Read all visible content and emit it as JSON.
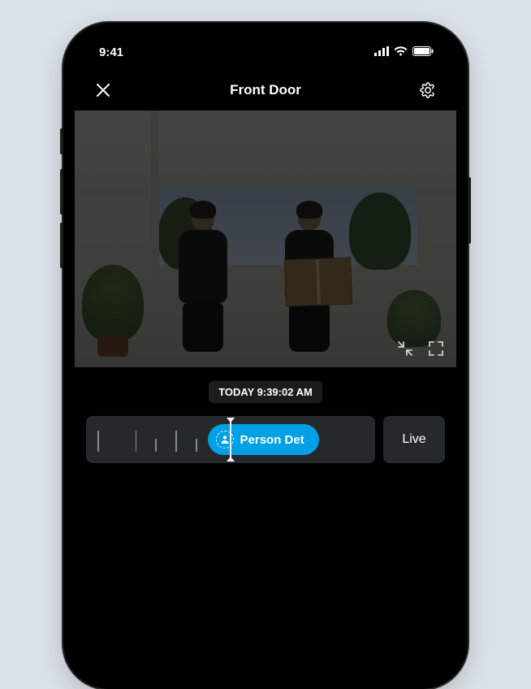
{
  "status": {
    "time": "9:41"
  },
  "header": {
    "title": "Front Door",
    "close_icon": "close-icon",
    "settings_icon": "gear-icon"
  },
  "timestamp": {
    "label": "TODAY 9:39:02 AM"
  },
  "timeline": {
    "event": {
      "label": "Person Det",
      "icon": "person-icon"
    },
    "live_label": "Live",
    "ticks": [
      {
        "pos": 4,
        "size": "tall"
      },
      {
        "pos": 17,
        "size": "tall"
      },
      {
        "pos": 24,
        "size": "short"
      },
      {
        "pos": 31,
        "size": "tall"
      },
      {
        "pos": 38,
        "size": "short"
      }
    ]
  },
  "video_controls": {
    "shrink_icon": "minimize-icon",
    "fullscreen_icon": "fullscreen-icon"
  }
}
